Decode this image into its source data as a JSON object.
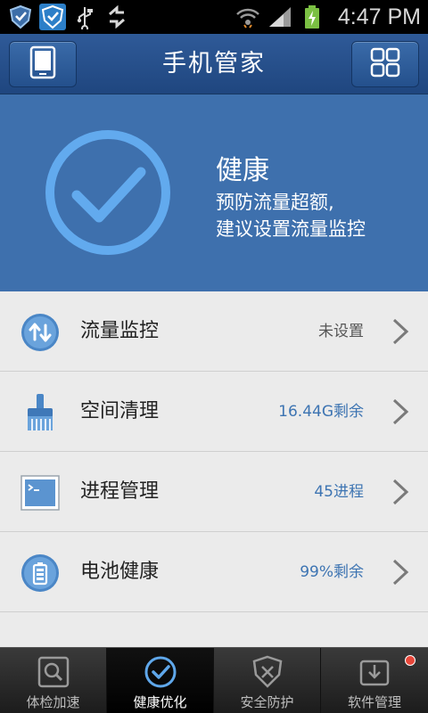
{
  "status_bar": {
    "time": "4:47 PM",
    "icons": [
      "shield-app-icon",
      "shield-app-icon-2",
      "usb-icon",
      "sync-icon",
      "wifi-icon",
      "signal-icon",
      "battery-charging-icon"
    ]
  },
  "header": {
    "title": "手机管家",
    "left_button_icon": "phone-icon",
    "right_button_icon": "grid-icon"
  },
  "hero": {
    "status": "健康",
    "line1": "预防流量超额,",
    "line2": "建议设置流量监控",
    "icon": "check-circle-icon"
  },
  "list": {
    "items": [
      {
        "label": "流量监控",
        "value": "未设置",
        "icon": "traffic-arrows-icon"
      },
      {
        "label": "空间清理",
        "value": "16.44G剩余",
        "icon": "broom-icon"
      },
      {
        "label": "进程管理",
        "value": "45进程",
        "icon": "terminal-icon"
      },
      {
        "label": "电池健康",
        "value": "99%剩余",
        "icon": "battery-icon"
      }
    ]
  },
  "tabs": [
    {
      "label": "体检加速",
      "icon": "magnifier-icon",
      "active": false
    },
    {
      "label": "健康优化",
      "icon": "check-circle-icon",
      "active": true
    },
    {
      "label": "安全防护",
      "icon": "shield-x-icon",
      "active": false
    },
    {
      "label": "软件管理",
      "icon": "box-icon",
      "active": false,
      "badge": true
    }
  ],
  "colors": {
    "header": "#2a5593",
    "hero": "#3e70ad",
    "ring": "#5fa7ea",
    "list_bg": "#ebebeb",
    "value_blue": "#3d74b2",
    "badge": "#e8473a"
  }
}
